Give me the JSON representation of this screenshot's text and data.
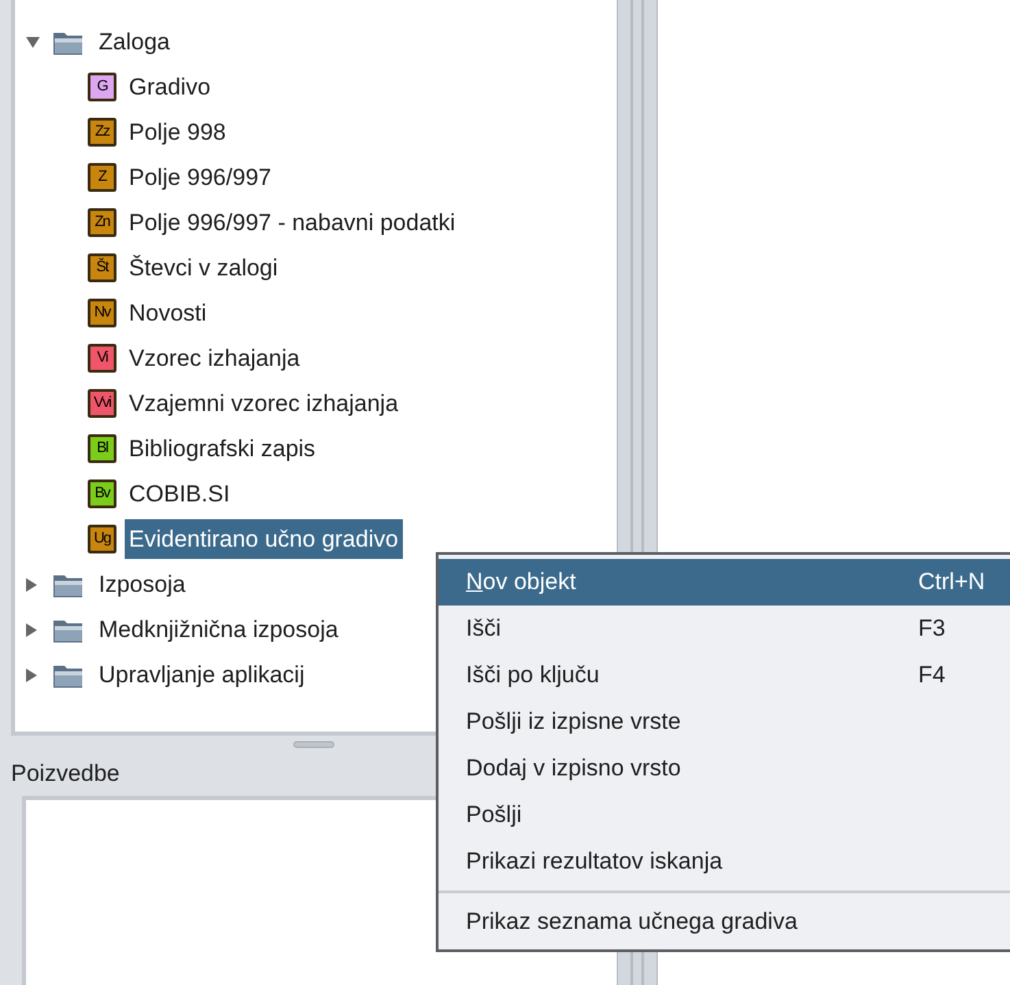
{
  "tree": [
    {
      "label": "Zaloga",
      "kind": "folder",
      "expanded": true,
      "selected": false,
      "children": [
        {
          "label": "Gradivo",
          "kind": "badge",
          "badge": "G",
          "color": "#dca7f0",
          "selected": false
        },
        {
          "label": "Polje 998",
          "kind": "badge",
          "badge": "Zz",
          "color": "#c8860f",
          "selected": false
        },
        {
          "label": "Polje 996/997",
          "kind": "badge",
          "badge": "Z",
          "color": "#c8860f",
          "selected": false
        },
        {
          "label": "Polje 996/997 - nabavni podatki",
          "kind": "badge",
          "badge": "Zn",
          "color": "#c8860f",
          "selected": false
        },
        {
          "label": "Števci v zalogi",
          "kind": "badge",
          "badge": "Št",
          "color": "#c8860f",
          "selected": false
        },
        {
          "label": "Novosti",
          "kind": "badge",
          "badge": "Nv",
          "color": "#c8860f",
          "selected": false
        },
        {
          "label": "Vzorec izhajanja",
          "kind": "badge",
          "badge": "Vi",
          "color": "#f0566a",
          "selected": false
        },
        {
          "label": "Vzajemni vzorec izhajanja",
          "kind": "badge",
          "badge": "Vvi",
          "color": "#f0566a",
          "selected": false
        },
        {
          "label": "Bibliografski zapis",
          "kind": "badge",
          "badge": "Bl",
          "color": "#7ccc1c",
          "selected": false
        },
        {
          "label": "COBIB.SI",
          "kind": "badge",
          "badge": "Bv",
          "color": "#7ccc1c",
          "selected": false
        },
        {
          "label": "Evidentirano učno gradivo",
          "kind": "badge",
          "badge": "Ug",
          "color": "#c8860f",
          "selected": true
        }
      ]
    },
    {
      "label": "Izposoja",
      "kind": "folder",
      "expanded": false,
      "selected": false
    },
    {
      "label": "Medknjižnična izposoja",
      "kind": "folder",
      "expanded": false,
      "selected": false
    },
    {
      "label": "Upravljanje aplikacij",
      "kind": "folder",
      "expanded": false,
      "selected": false
    }
  ],
  "queries_panel": {
    "title": "Poizvedbe"
  },
  "context_menu": [
    {
      "label": "Nov objekt",
      "shortcut": "Ctrl+N",
      "selected": true,
      "mnemonic": true
    },
    {
      "label": "Išči",
      "shortcut": "F3",
      "selected": false,
      "mnemonic": false
    },
    {
      "label": "Išči po ključu",
      "shortcut": "F4",
      "selected": false,
      "mnemonic": false
    },
    {
      "label": "Pošlji iz izpisne vrste",
      "selected": false,
      "mnemonic": false
    },
    {
      "label": "Dodaj v izpisno vrsto",
      "selected": false,
      "mnemonic": false
    },
    {
      "label": "Pošlji",
      "selected": false,
      "mnemonic": false
    },
    {
      "label": "Prikazi rezultatov iskanja",
      "selected": false,
      "mnemonic": false
    },
    {
      "kind": "separator"
    },
    {
      "label": "Prikaz seznama učnega gradiva",
      "selected": false,
      "mnemonic": false
    }
  ]
}
